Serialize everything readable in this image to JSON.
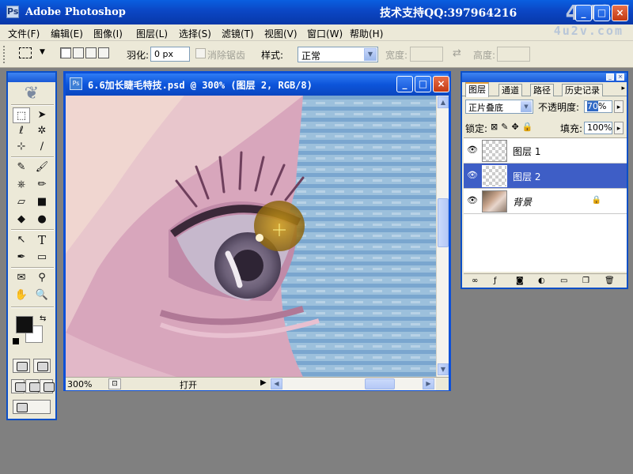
{
  "app": {
    "title": "Adobe Photoshop",
    "support_text": "技术支持QQ:397964216",
    "watermark": "4U2V",
    "watermark_domain": "4u2v.com",
    "minimize": "_",
    "maximize": "□",
    "close": "×"
  },
  "menu": {
    "items": [
      "文件(F)",
      "编辑(E)",
      "图像(I)",
      "图层(L)",
      "选择(S)",
      "滤镜(T)",
      "视图(V)",
      "窗口(W)",
      "帮助(H)"
    ]
  },
  "options": {
    "feather_label": "羽化:",
    "feather_value": "0 px",
    "antialias_label": "消除锯齿",
    "style_label": "样式:",
    "style_value": "正常",
    "width_label": "宽度:",
    "height_label": "高度:",
    "width_value": "",
    "height_value": ""
  },
  "toolbox": {
    "tools": [
      "⬚",
      "➤",
      "ℓ",
      "✲",
      "⊹",
      "∕",
      "✎",
      "🖌",
      "⎈",
      "✏",
      "▱",
      "■",
      "◆",
      "●",
      "↖",
      "T",
      "✒",
      "▭",
      "✉",
      "⚲",
      "✋",
      "🔍"
    ],
    "fg_color": "#111111",
    "bg_color": "#ffffff"
  },
  "document": {
    "title": "6.6加长睫毛特技.psd @ 300% (图层 2, RGB/8)",
    "zoom": "300%",
    "status_text": "打开",
    "more_arrow": "▶",
    "scroll_left": "◀",
    "scroll_right": "▶",
    "scroll_up": "▲",
    "scroll_down": "▼"
  },
  "layers_panel": {
    "tabs": [
      "图层",
      "通道",
      "路径",
      "历史记录"
    ],
    "active_tab": "图层",
    "blend_mode": "正片叠底",
    "opacity_label": "不透明度:",
    "opacity_value": "70",
    "opacity_suffix": "%",
    "lock_label": "锁定:",
    "fill_label": "填充:",
    "fill_value": "100%",
    "layers": [
      {
        "name": "图层 1",
        "visible": true,
        "selected": false
      },
      {
        "name": "图层 2",
        "visible": true,
        "selected": true
      },
      {
        "name": "背景",
        "visible": true,
        "selected": false,
        "locked": true
      }
    ]
  },
  "colors": {
    "titlebar_blue": "#0b46c4",
    "panel_bg": "#ece9d8",
    "workspace": "#808080",
    "selection_blue": "#3e5ec6"
  }
}
